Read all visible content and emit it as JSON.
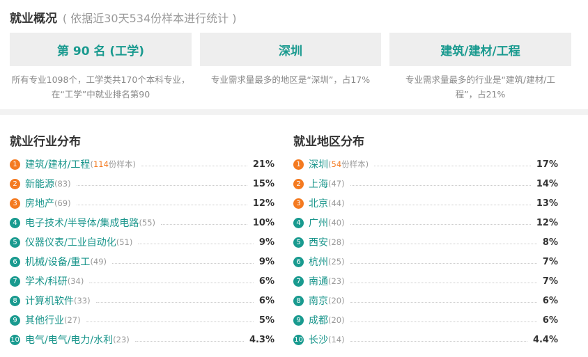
{
  "header": {
    "title": "就业概况",
    "subtitle": "( 依据近30天534份样本进行统计 )"
  },
  "cards": [
    {
      "label": "第 90 名 (工学)",
      "desc": "所有专业1098个，工学类共170个本科专业，在“工学”中就业排名第90"
    },
    {
      "label": "深圳",
      "desc": "专业需求量最多的地区是“深圳”，占17%"
    },
    {
      "label": "建筑/建材/工程",
      "desc": "专业需求量最多的行业是“建筑/建材/工程”，占21%"
    }
  ],
  "industry": {
    "title": "就业行业分布",
    "items": [
      {
        "rank": "1",
        "name": "建筑/建材/工程",
        "count_pre": "(",
        "count_num": "114",
        "count_post": "份样本)",
        "pct": "21%"
      },
      {
        "rank": "2",
        "name": "新能源",
        "count": "(83)",
        "pct": "15%"
      },
      {
        "rank": "3",
        "name": "房地产",
        "count": "(69)",
        "pct": "12%"
      },
      {
        "rank": "4",
        "name": "电子技术/半导体/集成电路",
        "count": "(55)",
        "pct": "10%"
      },
      {
        "rank": "5",
        "name": "仪器仪表/工业自动化",
        "count": "(51)",
        "pct": "9%"
      },
      {
        "rank": "6",
        "name": "机械/设备/重工",
        "count": "(49)",
        "pct": "9%"
      },
      {
        "rank": "7",
        "name": "学术/科研",
        "count": "(34)",
        "pct": "6%"
      },
      {
        "rank": "8",
        "name": "计算机软件",
        "count": "(33)",
        "pct": "6%"
      },
      {
        "rank": "9",
        "name": "其他行业",
        "count": "(27)",
        "pct": "5%"
      },
      {
        "rank": "10",
        "name": "电气/电气/电力/水利",
        "count": "(23)",
        "pct": "4.3%"
      }
    ]
  },
  "region": {
    "title": "就业地区分布",
    "items": [
      {
        "rank": "1",
        "name": "深圳",
        "count_pre": "(",
        "count_num": "54",
        "count_post": "份样本)",
        "pct": "17%"
      },
      {
        "rank": "2",
        "name": "上海",
        "count": "(47)",
        "pct": "14%"
      },
      {
        "rank": "3",
        "name": "北京",
        "count": "(44)",
        "pct": "13%"
      },
      {
        "rank": "4",
        "name": "广州",
        "count": "(40)",
        "pct": "12%"
      },
      {
        "rank": "5",
        "name": "西安",
        "count": "(28)",
        "pct": "8%"
      },
      {
        "rank": "6",
        "name": "杭州",
        "count": "(25)",
        "pct": "7%"
      },
      {
        "rank": "7",
        "name": "南通",
        "count": "(23)",
        "pct": "7%"
      },
      {
        "rank": "8",
        "name": "南京",
        "count": "(20)",
        "pct": "6%"
      },
      {
        "rank": "9",
        "name": "成都",
        "count": "(20)",
        "pct": "6%"
      },
      {
        "rank": "10",
        "name": "长沙",
        "count": "(14)",
        "pct": "4.4%"
      }
    ]
  },
  "colors": {
    "accent": "#1a9a8f",
    "highlight": "#f47a20"
  }
}
